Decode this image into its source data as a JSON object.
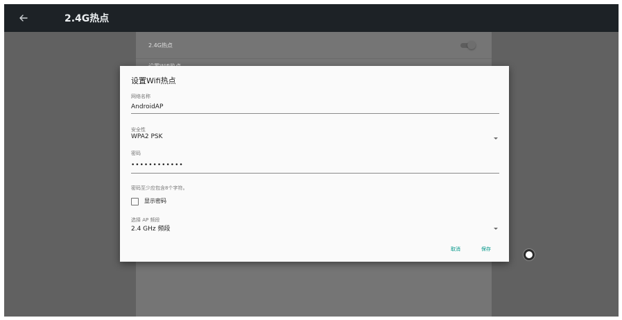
{
  "appbar": {
    "title": "2.4G热点",
    "back_icon": "arrow-left-icon"
  },
  "settings_rows": [
    {
      "label": "2.4G热点",
      "toggle_on": false
    },
    {
      "label": "设置Wifi热点"
    }
  ],
  "dialog": {
    "title": "设置Wifi热点",
    "network_name": {
      "label": "网络名称",
      "value": "AndroidAP"
    },
    "security": {
      "label": "安全性",
      "value": "WPA2 PSK"
    },
    "password": {
      "label": "密码",
      "value": "••••••••••••"
    },
    "password_hint": "密码至少应包含8个字符。",
    "show_password": {
      "label": "显示密码",
      "checked": false
    },
    "ap_band": {
      "label": "选择 AP 频段",
      "value": "2.4 GHz 频段"
    },
    "cancel_label": "取消",
    "save_label": "保存"
  },
  "colors": {
    "accent": "#009688",
    "appbar": "#1d2226",
    "scrim": "#616161",
    "dialog": "#fafafa"
  }
}
